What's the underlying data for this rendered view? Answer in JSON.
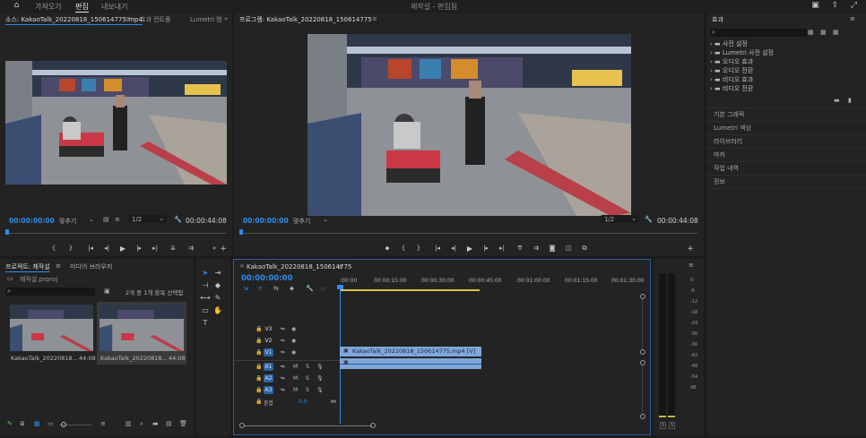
{
  "app": {
    "nav": [
      "가져오기",
      "편집",
      "내보내기"
    ],
    "active_nav": 1,
    "project_title": "제작설 - 편집됨"
  },
  "source": {
    "tabs": [
      "소스: KakaoTalk_20220818_150614775.mp4",
      "효과 컨트롤",
      "Lumetri 범"
    ],
    "timecode_in": "00:00:00:00",
    "fit": "맞추기",
    "resolution": "1/2",
    "timecode_out": "00:00:44:08"
  },
  "program": {
    "tab": "프로그램: KakaoTalk_20220818_150614775",
    "timecode_in": "00:00:00:00",
    "fit": "맞추기",
    "resolution": "1/2",
    "timecode_out": "00:00:44:08"
  },
  "effects": {
    "title": "효과",
    "search_placeholder": "",
    "items": [
      "사전 설정",
      "Lumetri 사전 설정",
      "오디오 효과",
      "오디오 전환",
      "비디오 효과",
      "비디오 전환"
    ]
  },
  "side_panels": [
    "기본 그래픽",
    "Lumetri 색상",
    "라이브러리",
    "마커",
    "작업 내역",
    "정보"
  ],
  "project": {
    "tabs": [
      "프로젝트: 제작설",
      "미디어 브라우저"
    ],
    "path": "제작설.prproj",
    "search_placeholder": "",
    "count": "2개 중 1개 항목 선택됨",
    "bins": [
      {
        "name": "KakaoTalk_20220818...",
        "duration": "44:08"
      },
      {
        "name": "KakaoTalk_20220818...",
        "duration": "44:08"
      }
    ]
  },
  "timeline": {
    "tab": "KakaoTalk_20220818_150614775",
    "timecode": "00:00:00:00",
    "ruler": [
      ":00:00",
      "00:00:15:00",
      "00:00:30:00",
      "00:00:45:00",
      "00:01:00:00",
      "00:01:15:00",
      "00:01:30:00"
    ],
    "video_tracks": [
      "V3",
      "V2",
      "V1"
    ],
    "audio_tracks": [
      "A1",
      "A2",
      "A3"
    ],
    "mix_label": "혼합",
    "mix_value": "0.0",
    "clip_label": "KakaoTalk_20220818_150614775.mp4 [V]"
  },
  "meter": {
    "scale": [
      "0",
      "-6",
      "-12",
      "-18",
      "-24",
      "-30",
      "-36",
      "-42",
      "-48",
      "-54",
      "dB"
    ],
    "channels": [
      "S",
      "S"
    ]
  },
  "colors": {
    "accent": "#2d8ceb",
    "clip": "#7ea7dc",
    "playhead": "#2d8ceb"
  }
}
